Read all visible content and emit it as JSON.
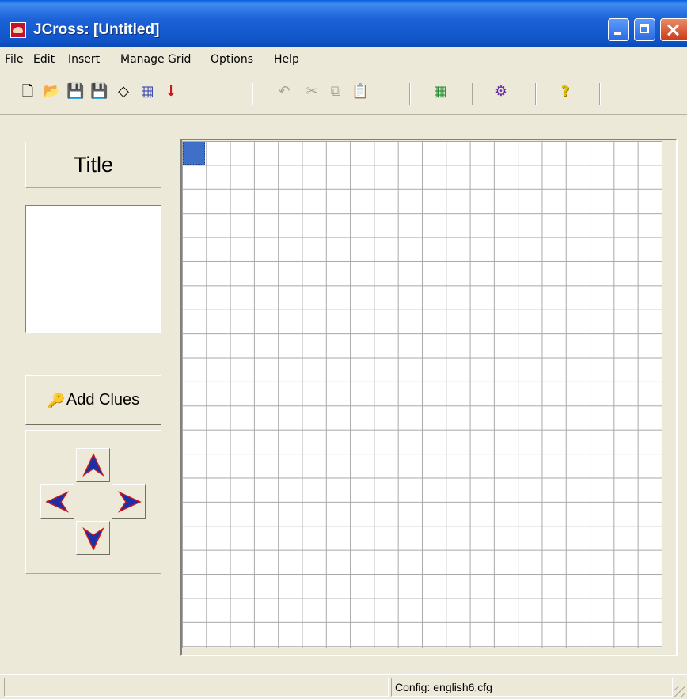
{
  "window": {
    "title": "JCross: [Untitled]"
  },
  "menu": {
    "items": [
      "File",
      "Edit",
      "Insert",
      "Manage Grid",
      "Options",
      "Help"
    ]
  },
  "toolbar": {
    "buttons": [
      {
        "icon": "new-icon",
        "glyph": "🗋",
        "enabled": true
      },
      {
        "icon": "open-icon",
        "glyph": "📂",
        "enabled": true
      },
      {
        "icon": "save-icon",
        "glyph": "💾",
        "enabled": true
      },
      {
        "icon": "save-as-icon",
        "glyph": "💾",
        "enabled": true
      },
      {
        "icon": "clear-icon",
        "glyph": "◇",
        "enabled": true
      },
      {
        "icon": "export-web-icon",
        "glyph": "▦",
        "enabled": true
      },
      {
        "icon": "download-arrow-icon",
        "glyph": "↓",
        "enabled": true
      },
      {
        "icon": "undo-icon",
        "glyph": "↶",
        "enabled": false
      },
      {
        "icon": "cut-icon",
        "glyph": "✂",
        "enabled": false
      },
      {
        "icon": "copy-icon",
        "glyph": "⧉",
        "enabled": false
      },
      {
        "icon": "paste-icon",
        "glyph": "📋",
        "enabled": false
      },
      {
        "icon": "grid-maker-icon",
        "glyph": "▦",
        "enabled": true
      },
      {
        "icon": "configuration-icon",
        "glyph": "⚙",
        "enabled": true
      },
      {
        "icon": "help-icon",
        "glyph": "?",
        "enabled": true
      }
    ]
  },
  "left_panel": {
    "title_button": "Title",
    "title_text": "",
    "add_clues_button": "Add Clues"
  },
  "grid": {
    "columns": 20,
    "rows": 21,
    "selected_cell": [
      0,
      0
    ]
  },
  "statusbar": {
    "left": "",
    "config": "Config: english6.cfg"
  },
  "colors": {
    "titlebar": "#0f55c8",
    "selected_cell": "#3f6fc6",
    "arrow_fill": "#1a2fa8",
    "arrow_outline": "#c81a1a",
    "help_icon": "#e0c000"
  }
}
